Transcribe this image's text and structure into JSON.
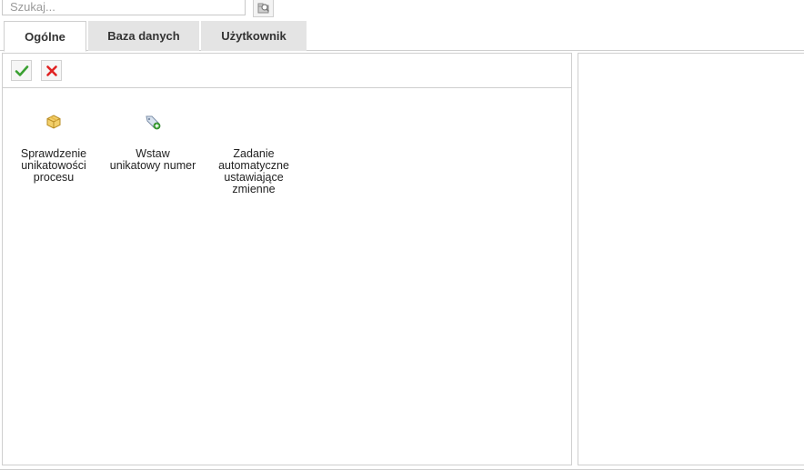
{
  "search": {
    "placeholder": "Szukaj...",
    "value": ""
  },
  "icons": {
    "search_button": "search-folder-icon",
    "accept": "checkmark-icon",
    "cancel": "cross-icon"
  },
  "tabs": [
    {
      "label": "Ogólne",
      "active": true
    },
    {
      "label": "Baza danych",
      "active": false
    },
    {
      "label": "Użytkownik",
      "active": false
    }
  ],
  "items": [
    {
      "label": "Sprawdzenie\nunikatowości\nprocesu",
      "icon": "package-icon"
    },
    {
      "label": "Wstaw\nunikatowy numer",
      "icon": "tag-add-icon"
    },
    {
      "label": "Zadanie\nautomatyczne\nustawiające\nzmienne",
      "icon": "none"
    }
  ],
  "colors": {
    "accept": "#3aa032",
    "cancel": "#e02222",
    "border": "#cfcfcf",
    "tab_inactive": "#e4e4e4"
  }
}
